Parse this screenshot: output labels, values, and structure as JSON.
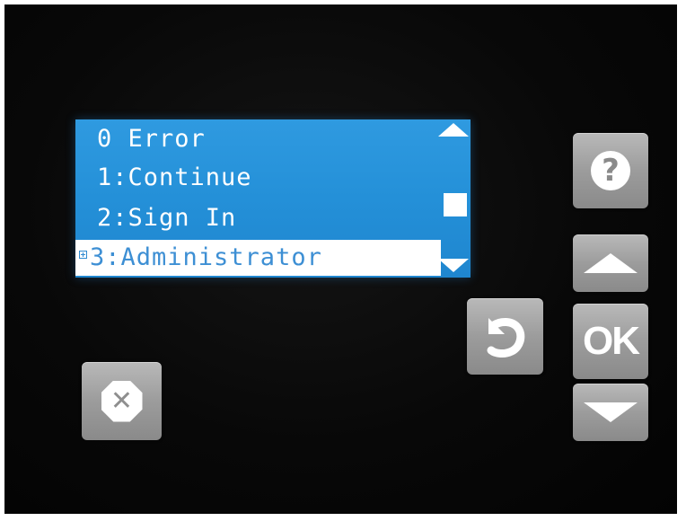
{
  "screen": {
    "menu_items": [
      {
        "label": "0 Error"
      },
      {
        "label": "1:Continue"
      },
      {
        "label": "2:Sign In"
      },
      {
        "label": "3:Administrator",
        "selected": true,
        "expandable": true
      }
    ],
    "scrollbar": {
      "up_icon": "scroll-up-arrow",
      "down_icon": "scroll-down-arrow"
    },
    "colors": {
      "screen_background": "#2490d8",
      "selected_text": "#3d8fd4"
    }
  },
  "buttons": {
    "help": {
      "icon": "help-icon",
      "glyph": "?"
    },
    "up": {
      "icon": "up-arrow-icon"
    },
    "ok": {
      "label": "OK"
    },
    "down": {
      "icon": "down-arrow-icon"
    },
    "back": {
      "icon": "back-arrow-icon"
    },
    "cancel": {
      "icon": "cancel-icon",
      "glyph": "✕"
    }
  }
}
